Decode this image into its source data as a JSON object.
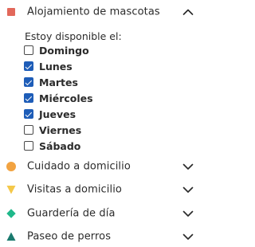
{
  "sections": [
    {
      "label": "Alojamiento de mascotas",
      "marker_color": "#e2685b",
      "expanded": true
    },
    {
      "label": "Cuidado a domicilio",
      "marker_color": "#f2a341",
      "expanded": false
    },
    {
      "label": "Visitas a domicilio",
      "marker_color": "#f4c84a",
      "expanded": false
    },
    {
      "label": "Guardería de día",
      "marker_color": "#1fb88a",
      "expanded": false
    },
    {
      "label": "Paseo de perros",
      "marker_color": "#1a7a6e",
      "expanded": false
    }
  ],
  "availability": {
    "title": "Estoy disponible el:",
    "days": [
      {
        "label": "Domingo",
        "checked": false
      },
      {
        "label": "Lunes",
        "checked": true
      },
      {
        "label": "Martes",
        "checked": true
      },
      {
        "label": "Miércoles",
        "checked": true
      },
      {
        "label": "Jueves",
        "checked": true
      },
      {
        "label": "Viernes",
        "checked": false
      },
      {
        "label": "Sábado",
        "checked": false
      }
    ]
  }
}
